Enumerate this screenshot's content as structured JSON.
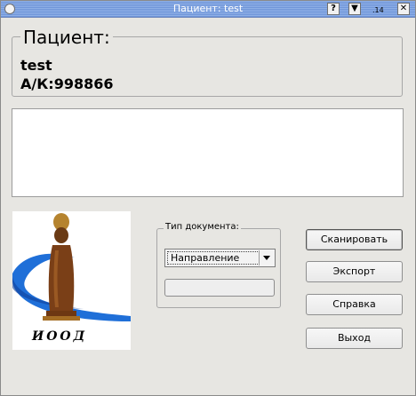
{
  "window": {
    "title": "Пациент: test",
    "title_help": "?",
    "title_arrow": "▼",
    "title_close": "✕",
    "title_extra": ".14"
  },
  "patient": {
    "group_title": "Пациент:",
    "name": "test",
    "card": "А/К:998866"
  },
  "logo": {
    "text": "ИООД"
  },
  "document": {
    "group_title": "Тип документа:",
    "selected": "Направление",
    "progress": 0
  },
  "buttons": {
    "scan": "Сканировать",
    "export": "Экспорт",
    "help": "Справка",
    "exit": "Выход"
  },
  "colors": {
    "titlebar": "#7aa0e0",
    "logo_swoosh": "#1e6fd6",
    "statue": "#8a4b1e"
  }
}
